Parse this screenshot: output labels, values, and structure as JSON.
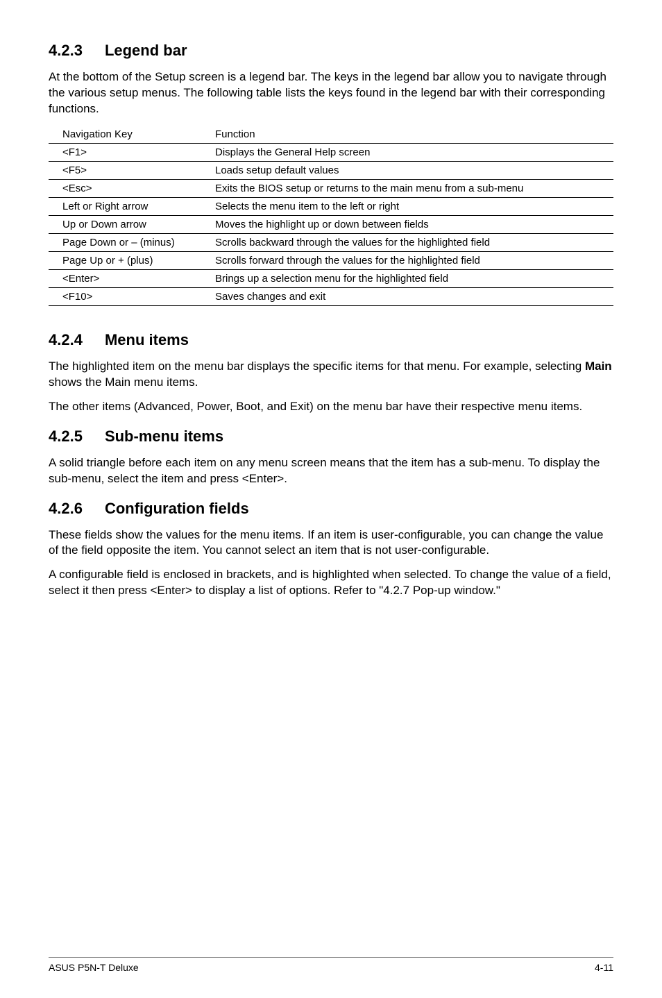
{
  "s423": {
    "num": "4.2.3",
    "title": "Legend bar",
    "intro": "At the bottom of the Setup screen is a legend bar. The keys in the legend bar allow you to navigate through the various setup menus. The following table lists the keys found in the legend bar with their corresponding functions.",
    "table": {
      "header": {
        "key": "Navigation Key",
        "fn": "Function"
      },
      "rows": [
        {
          "key": "<F1>",
          "fn": "Displays the General Help screen"
        },
        {
          "key": "<F5>",
          "fn": "Loads setup default values"
        },
        {
          "key": "<Esc>",
          "fn": "Exits the BIOS setup or returns to the main menu from a sub-menu"
        },
        {
          "key": "Left or Right arrow",
          "fn": "Selects the menu item to the left or right"
        },
        {
          "key": "Up or Down arrow",
          "fn": "Moves the highlight up or down between fields"
        },
        {
          "key": "Page Down or – (minus)",
          "fn": "Scrolls backward through the values for the highlighted field"
        },
        {
          "key": "Page Up or + (plus)",
          "fn": "Scrolls forward through the values for the highlighted field"
        },
        {
          "key": "<Enter>",
          "fn": "Brings up a selection menu for the highlighted field"
        },
        {
          "key": "<F10>",
          "fn": "Saves changes and exit"
        }
      ]
    }
  },
  "s424": {
    "num": "4.2.4",
    "title": "Menu items",
    "p1_pre": "The highlighted item on the menu bar  displays the specific items for that menu. For example, selecting ",
    "p1_bold": "Main",
    "p1_post": " shows the Main menu items.",
    "p2": "The other items (Advanced, Power, Boot, and Exit) on the menu bar have their respective menu items."
  },
  "s425": {
    "num": "4.2.5",
    "title": "Sub-menu items",
    "p1": "A solid triangle before each item on any menu screen means that the item has a sub-menu. To display the sub-menu, select the item and press <Enter>."
  },
  "s426": {
    "num": "4.2.6",
    "title": "Configuration fields",
    "p1": "These fields show the values for the menu items. If an item is user-configurable, you can change the value of the field opposite the item. You cannot select an item that is not user-configurable.",
    "p2": "A configurable field is enclosed in brackets, and is highlighted when selected. To change the value of a field, select it then press <Enter> to display a list of options. Refer to \"4.2.7 Pop-up window.\""
  },
  "footer": {
    "left": "ASUS P5N-T Deluxe",
    "right": "4-11"
  }
}
